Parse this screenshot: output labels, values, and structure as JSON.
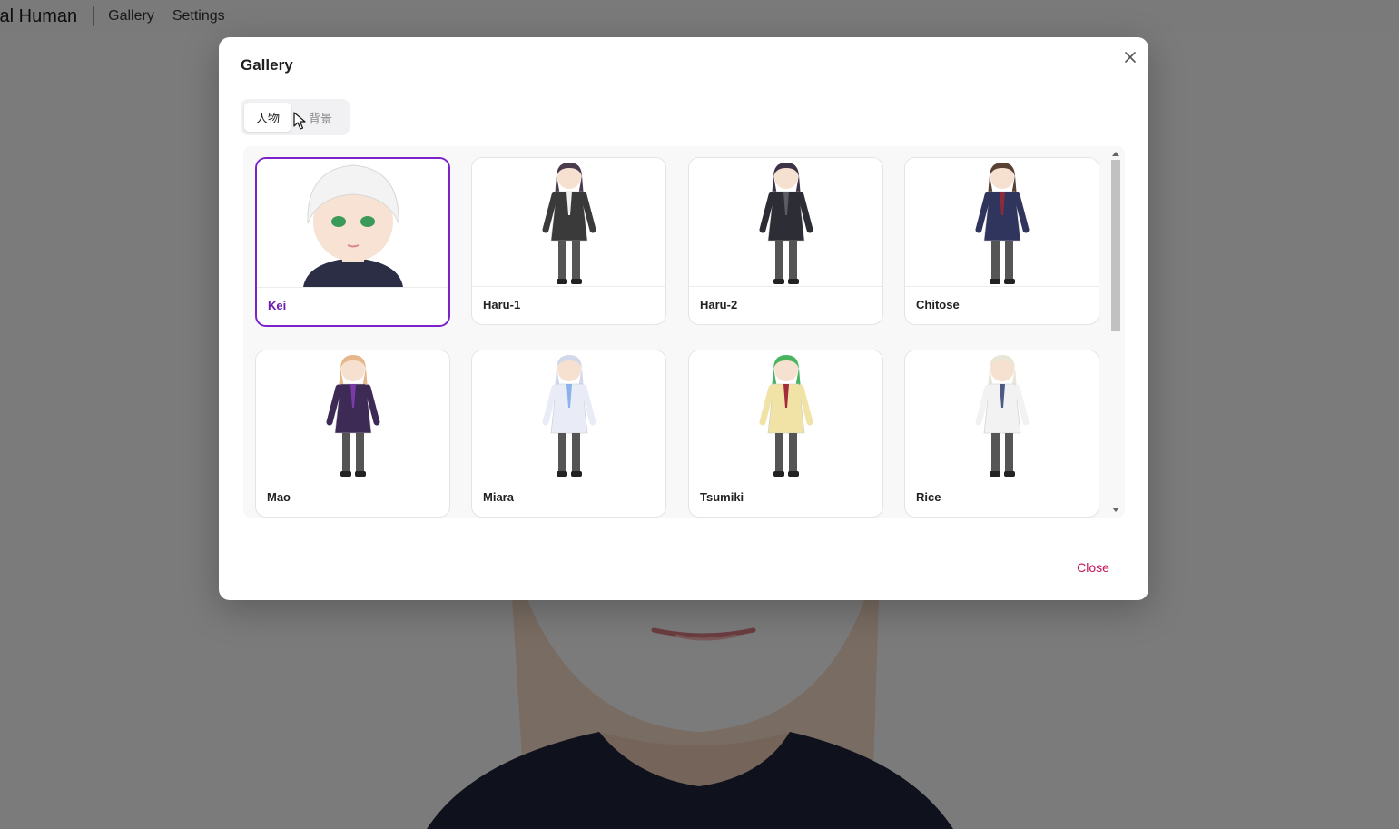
{
  "app": {
    "title": "tal Human",
    "nav": [
      {
        "label": "Gallery"
      },
      {
        "label": "Settings"
      }
    ]
  },
  "modal": {
    "title": "Gallery",
    "tabs": [
      {
        "label": "人物",
        "active": true
      },
      {
        "label": "背景",
        "active": false
      }
    ],
    "characters": [
      {
        "name": "Kei",
        "selected": true,
        "colors": {
          "hair": "#f3f3f3",
          "body": "#2b2e44",
          "accent": "#3b9a5a"
        }
      },
      {
        "name": "Haru-1",
        "selected": false,
        "colors": {
          "hair": "#4a3c4c",
          "body": "#3a3a3a",
          "accent": "#f0f0f0"
        }
      },
      {
        "name": "Haru-2",
        "selected": false,
        "colors": {
          "hair": "#3d3448",
          "body": "#2d2d35",
          "accent": "#5c5c66"
        }
      },
      {
        "name": "Chitose",
        "selected": false,
        "colors": {
          "hair": "#5a4135",
          "body": "#2f355c",
          "accent": "#8e2b3a"
        }
      },
      {
        "name": "Mao",
        "selected": false,
        "colors": {
          "hair": "#e7b68a",
          "body": "#3d2a55",
          "accent": "#7a3aa8"
        }
      },
      {
        "name": "Miara",
        "selected": false,
        "colors": {
          "hair": "#d2d8ea",
          "body": "#e9ecf6",
          "accent": "#8ab4e8"
        }
      },
      {
        "name": "Tsumiki",
        "selected": false,
        "colors": {
          "hair": "#48b55e",
          "body": "#f1e2a6",
          "accent": "#a22c3c"
        }
      },
      {
        "name": "Rice",
        "selected": false,
        "colors": {
          "hair": "#e8e6d6",
          "body": "#f2f2f2",
          "accent": "#4e5a86"
        }
      }
    ],
    "close_label": "Close",
    "accent_color": "#7c22c9"
  }
}
